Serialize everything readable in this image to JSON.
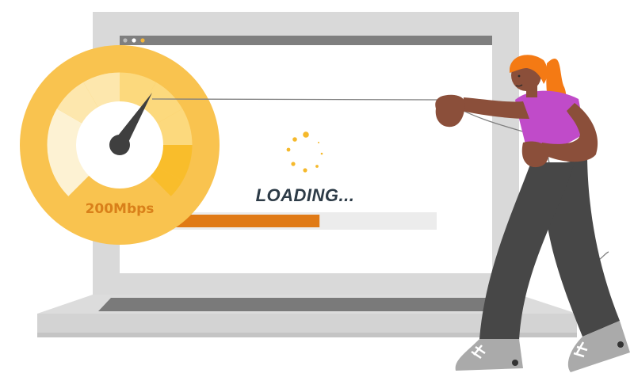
{
  "speedometer": {
    "speed_label": "200Mbps",
    "colors": {
      "outer_ring": "#f9c34f",
      "segment_light": "#fdf2d3",
      "segment_mid": "#fde7ad",
      "segment_warm": "#fcd97d",
      "segment_active": "#f9bd2b",
      "needle": "#3f3f3f"
    }
  },
  "browser": {
    "window_dots": [
      "#bdbdbd",
      "#ffffff",
      "#f3b53a"
    ],
    "loading_text": "LOADING...",
    "progress": 0.5,
    "colors": {
      "progress_fill": "#e07a16",
      "progress_track": "#ececec",
      "spinner": "#f5b92c"
    }
  },
  "laptop": {
    "colors": {
      "frame": "#d9d9d9",
      "titlebar": "#7f7f7f",
      "keyboard_deck": "#7a7a7a"
    }
  },
  "person": {
    "colors": {
      "hair": "#f47a14",
      "skin": "#8b4f3a",
      "shirt": "#c04bc9",
      "pants": "#474747",
      "shoes": "#aaaaaa"
    }
  }
}
